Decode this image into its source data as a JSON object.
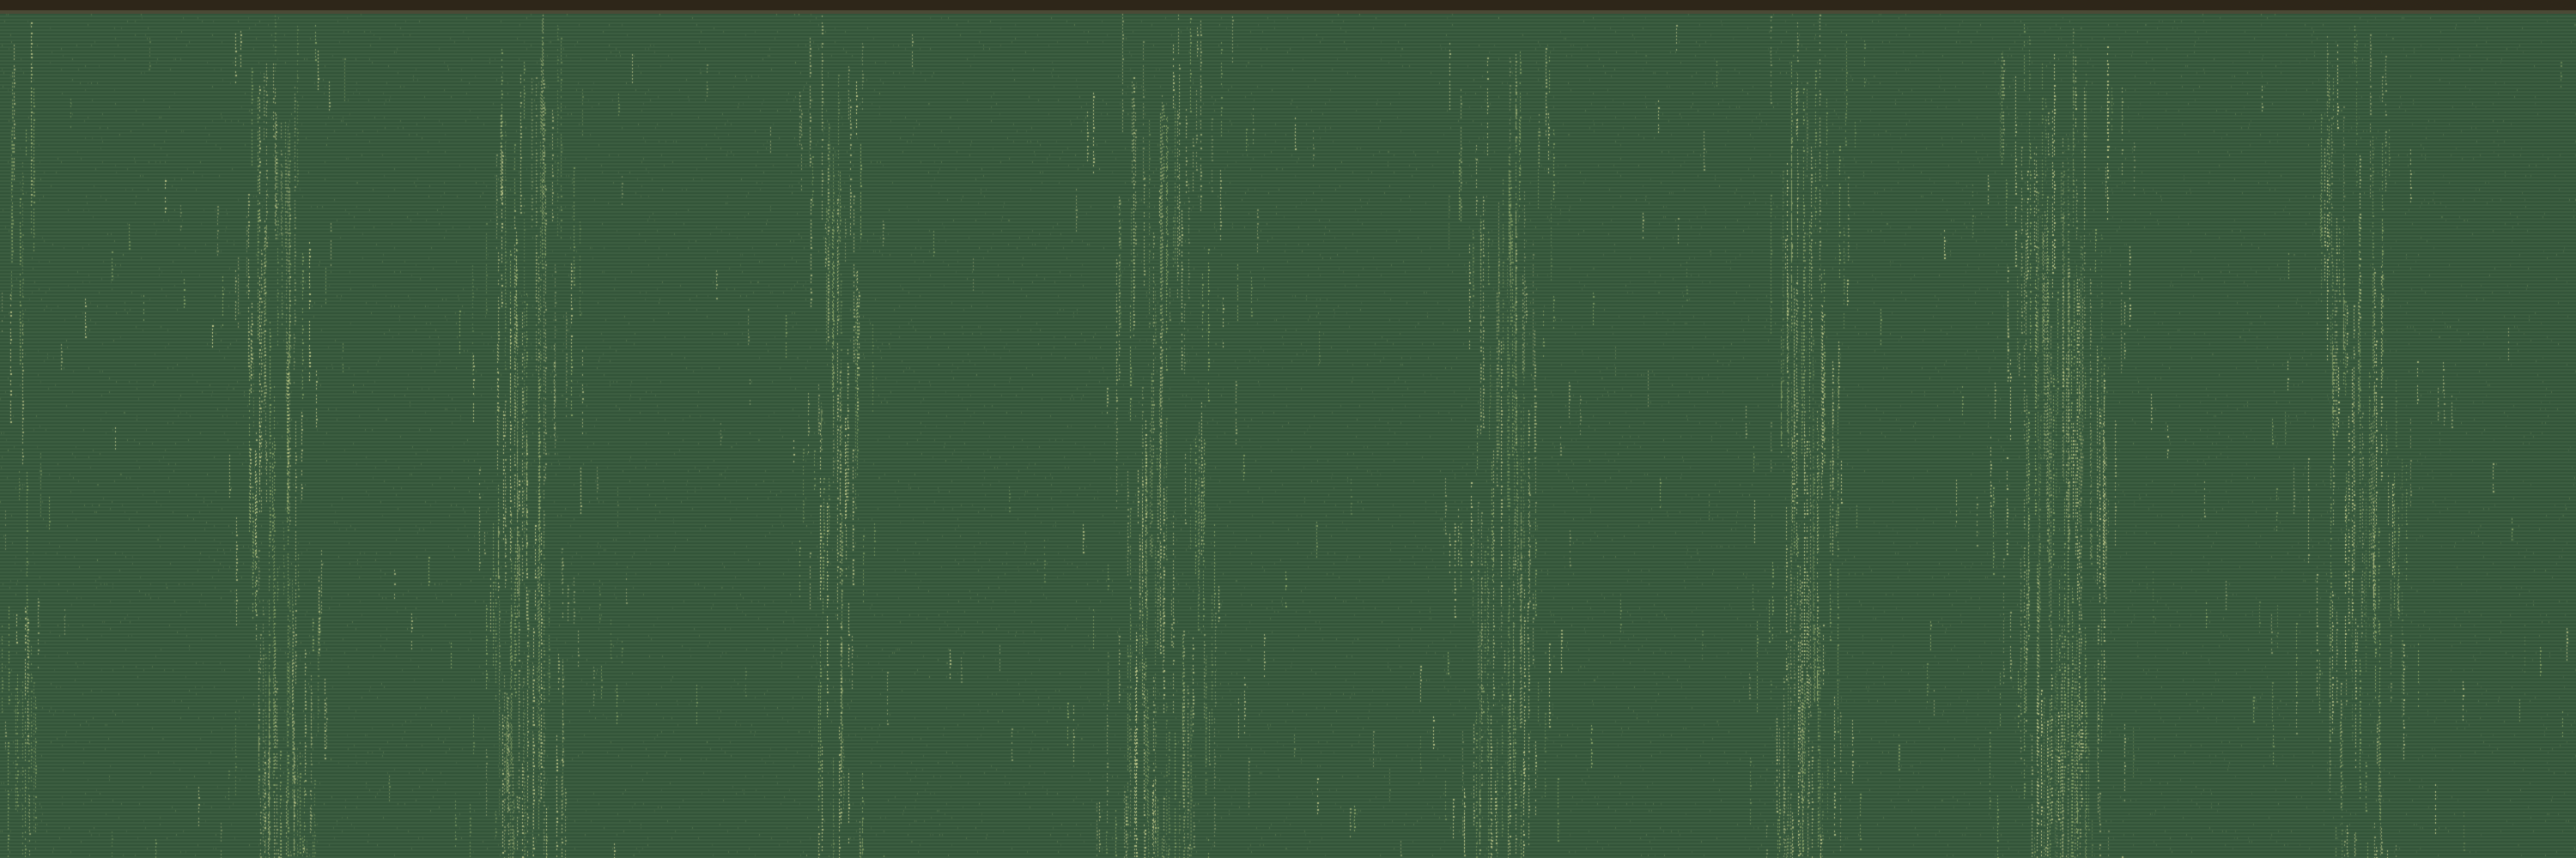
{
  "image": {
    "subject": "woven-textile-close-up",
    "description_colors": {
      "base": "#3d5f42",
      "base_dark": "#2f4d35",
      "thread_light": "#c9cf8f",
      "thread_mid": "#8fa86a",
      "scanline": "#33553a",
      "top_rail": "#2e2619",
      "top_rail_light": "#4b4a36"
    },
    "streak_bands": [
      {
        "center": 0.008,
        "width": 0.018,
        "intensity": 0.55
      },
      {
        "center": 0.108,
        "width": 0.03,
        "intensity": 0.8
      },
      {
        "center": 0.205,
        "width": 0.035,
        "intensity": 0.85
      },
      {
        "center": 0.325,
        "width": 0.028,
        "intensity": 0.6
      },
      {
        "center": 0.45,
        "width": 0.045,
        "intensity": 0.8
      },
      {
        "center": 0.583,
        "width": 0.035,
        "intensity": 0.7
      },
      {
        "center": 0.7,
        "width": 0.03,
        "intensity": 0.85
      },
      {
        "center": 0.8,
        "width": 0.045,
        "intensity": 0.9
      },
      {
        "center": 0.915,
        "width": 0.04,
        "intensity": 0.65
      }
    ]
  }
}
